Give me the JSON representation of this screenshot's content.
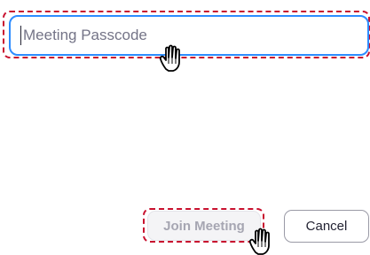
{
  "passcode": {
    "placeholder": "Meeting Passcode",
    "value": ""
  },
  "buttons": {
    "join_label": "Join Meeting",
    "cancel_label": "Cancel"
  },
  "colors": {
    "focus_border": "#2d8cff",
    "highlight": "#c8102e",
    "disabled_text": "#a6a6b2"
  },
  "icons": {
    "cursor": "hand-pointer-icon"
  }
}
